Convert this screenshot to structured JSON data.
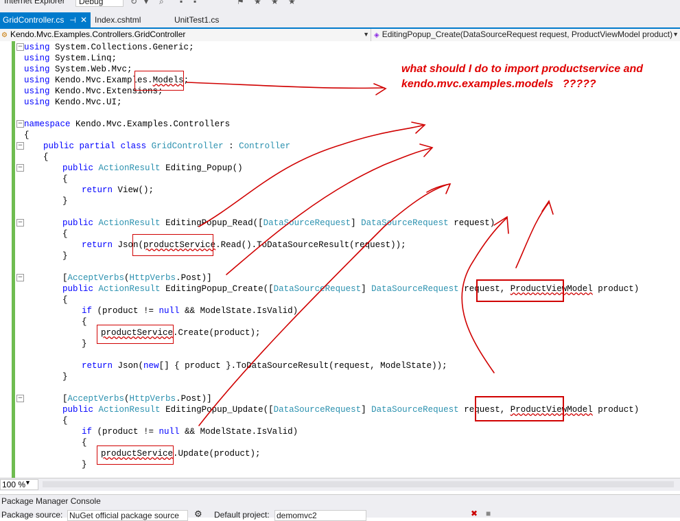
{
  "toolbar": {
    "browser_label": "Internet Explorer",
    "config_label": "Debug"
  },
  "tabs": [
    {
      "label": "GridController.cs",
      "active": true
    },
    {
      "label": "Index.cshtml",
      "active": false
    },
    {
      "label": "UnitTest1.cs",
      "active": false
    }
  ],
  "nav": {
    "type_path": "Kendo.Mvc.Examples.Controllers.GridController",
    "member": "EditingPopup_Create(DataSourceRequest request, ProductViewModel product)"
  },
  "annotation": {
    "line1": "what should I do to import productservice and",
    "line2": "kendo.mvc.examples.models   ?????"
  },
  "code": {
    "l1": "System.Collections.Generic;",
    "l2": "System.Linq;",
    "l3": "System.Web.Mvc;",
    "l4a": "Kendo.Mvc.Examples.",
    "l4b": "Models",
    "l4c": ";",
    "l5": "Kendo.Mvc.Extensions;",
    "l6": "Kendo.Mvc.UI;",
    "kw_using": "using",
    "kw_namespace": "namespace",
    "ns_name": "Kendo.Mvc.Examples.Controllers",
    "brace_open": "{",
    "brace_close": "}",
    "kw_public": "public",
    "kw_partial": "partial",
    "kw_class": "class",
    "class_name": "GridController",
    "colon": " : ",
    "base_class": "Controller",
    "action_result": "ActionResult",
    "m1": "Editing_Popup()",
    "kw_return": "return",
    "view_call": "View();",
    "m2": "EditingPopup_Read([",
    "dsr": "DataSourceRequest",
    "bracket_close": "]",
    "request": "request)",
    "json_open": "Json(",
    "product_service": "productService",
    "read_call": ".Read().ToDataSourceResult(request));",
    "accept_verbs": "AcceptVerbs",
    "http_verbs": "HttpVerbs",
    "post": ".Post)]",
    "m3": "EditingPopup_Create([",
    "request_comma": "request,",
    "pvm": "ProductViewModel",
    "product_param": "product)",
    "kw_if": "if",
    "if_text1": "(product != ",
    "kw_null": "null",
    "if_text2": " && ModelState.IsValid)",
    "create_call": ".Create(product);",
    "kw_new": "new",
    "return_json_a": "Json(",
    "return_json_b": "[] { product }.ToDataSourceResult(request, ModelState));",
    "m4": "EditingPopup_Update([",
    "update_call": ".Update(product);"
  },
  "status": {
    "zoom": "100 %"
  },
  "pmc": {
    "title": "Package Manager Console",
    "source_label": "Package source:",
    "source_value": "NuGet official package source",
    "project_label": "Default project:",
    "project_value": "demomvc2"
  }
}
